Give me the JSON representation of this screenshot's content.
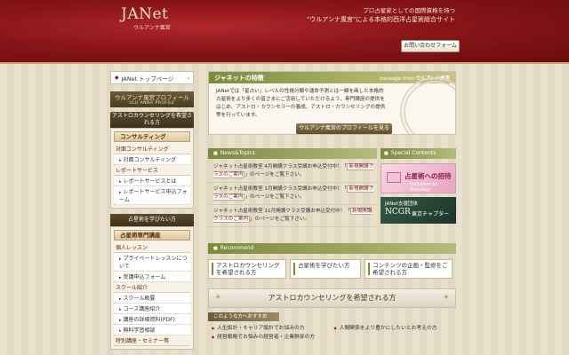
{
  "header": {
    "logo": "JANet",
    "logo_sub": "ウルアンナ風宮",
    "tagline1": "プロ占星家としての国際資格を持つ",
    "tagline2": "\"ウルアンナ風宮\"による本格的西洋占星術総合サイト",
    "contact_label": "お問い合わせフォーム"
  },
  "sidebar": {
    "top_label": "JANet トップページ",
    "banner_title": "ウルアンナ風宮プロフィール",
    "banner_sub": "ULU ANNA PROFILE",
    "section1_tab": "アストロカウンセリングを希望される方",
    "consult_head": "コンサルティング",
    "consult_sub1": "対面コンサルティング",
    "consult_link1": "対面コンサルティング",
    "report_sub": "レポートサービス",
    "report_link1": "レポートサービスとは",
    "report_link2": "レポートサービス申込フォーム",
    "section2_tab": "占星術を学びたい方",
    "school_head": "占星術専門講座",
    "lesson_sub": "個人レッスン",
    "lesson_link1": "プライベートレッスンについて",
    "lesson_link2": "受講申込フォーム",
    "school_sub": "スクール紹介",
    "school_link1": "スクール概要",
    "school_link2": "コース講座紹介",
    "school_link3": "講座の詳細資料(PDF)",
    "school_link4": "無料学習相談",
    "special_sub": "特別講座・セミナー等"
  },
  "features": {
    "title": "ジャネットの特徴",
    "message_prefix": "message from",
    "message_name": "ウルアンナ風宮",
    "body": "JANetでは「星占い」レベルの性格分類や運命予測とは一線を画した本格的占星術をより多くの皆さまにご活用していただけるよう、専門講座の提供をはじめ、アストロ・カウンセラーの養成、アストロ・カウンセリングの提供等を行っています。",
    "profile_button": "ウルアンナ風宮のプロフィールを見る"
  },
  "news": {
    "title": "News&Topics",
    "items": [
      {
        "pre": "ジャネット占星術教室 4月開講クラス受講お申込受付中！「",
        "link": "新規開講クラスのご案内",
        "post": "」のページをご覧下さい。"
      },
      {
        "pre": "ジャネット占星術教室 1月開講クラス受講お申込受付中！「",
        "link": "新規開講クラスのご案内",
        "post": "」のページをご覧下さい。"
      },
      {
        "pre": "ジャネット占星術教室 11月開講クラス受講お申込受付中！「",
        "link": "新規開講クラスのご案内",
        "post": "」のページをご覧下さい。"
      }
    ]
  },
  "special": {
    "title": "Special Contents",
    "card1_title": "占星術への招待",
    "card1_sub": "Invitation to Astrology",
    "card2_l1": "JANet支援団体",
    "card2_l2": "NCGR",
    "card2_l3": "東京チャプター"
  },
  "recommend": {
    "title": "Recommend",
    "cards": [
      "アストロカウンセリングを希望される方",
      "占星術を学びたい方",
      "コンテンツの企画・監修をご希望される方"
    ]
  },
  "astro": {
    "banner": "アストロカウンセリングを希望される方",
    "who_tab": "このような方へおすすめ",
    "items": [
      "人生設計・キャリア設計でお悩みの方",
      "人間関係をより豊かにしたいとお考えの方",
      "経営戦略でお悩みの経営者・企業幹部の方"
    ]
  }
}
